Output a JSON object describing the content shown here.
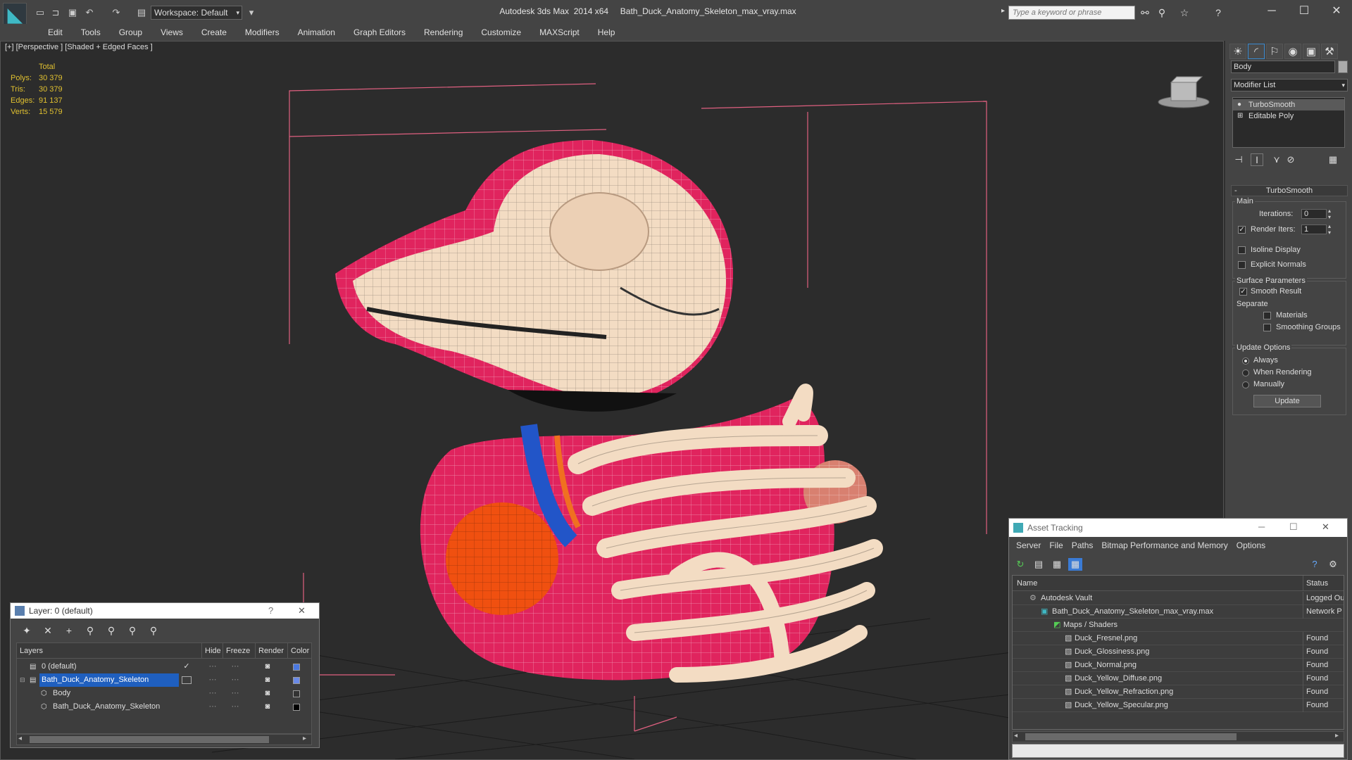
{
  "titlebar": {
    "app_title": "Autodesk 3ds Max  2014 x64     Bath_Duck_Anatomy_Skeleton_max_vray.max",
    "workspace_label": "Workspace: Default",
    "search_placeholder": "Type a keyword or phrase"
  },
  "menu": [
    "Edit",
    "Tools",
    "Group",
    "Views",
    "Create",
    "Modifiers",
    "Animation",
    "Graph Editors",
    "Rendering",
    "Customize",
    "MAXScript",
    "Help"
  ],
  "viewport": {
    "label": "[+] [Perspective ] [Shaded + Edged Faces ]",
    "stats_header": "Total",
    "stats": [
      {
        "k": "Polys:",
        "v": "30 379"
      },
      {
        "k": "Tris:",
        "v": "30 379"
      },
      {
        "k": "Edges:",
        "v": "91 137"
      },
      {
        "k": "Verts:",
        "v": "15 579"
      }
    ]
  },
  "command_panel": {
    "object_name": "Body",
    "modifier_list": "Modifier List",
    "stack": [
      "TurboSmooth",
      "Editable Poly"
    ],
    "rollout_title": "TurboSmooth",
    "main_group": "Main",
    "iterations_label": "Iterations:",
    "iterations_value": "0",
    "render_iters_label": "Render Iters:",
    "render_iters_value": "1",
    "isoline": "Isoline Display",
    "explicit": "Explicit Normals",
    "surface_group": "Surface Parameters",
    "smooth_result": "Smooth Result",
    "separate": "Separate",
    "materials": "Materials",
    "smoothing_groups": "Smoothing Groups",
    "update_group": "Update Options",
    "always": "Always",
    "when_rendering": "When Rendering",
    "manually": "Manually",
    "update_button": "Update"
  },
  "layer_window": {
    "title": "Layer: 0 (default)",
    "help": "?",
    "close": "✕",
    "columns": [
      "Layers",
      "Hide",
      "Freeze",
      "Render",
      "Color"
    ],
    "rows": [
      {
        "name": "0 (default)",
        "color": "#4a78e0"
      },
      {
        "name": "Bath_Duck_Anatomy_Skeleton",
        "color": "#6a8ae8"
      },
      {
        "name": "Body",
        "color": "#333333"
      },
      {
        "name": "Bath_Duck_Anatomy_Skeleton",
        "color": "#000000"
      }
    ]
  },
  "asset_window": {
    "title": "Asset Tracking",
    "menu": [
      "Server",
      "File",
      "Paths",
      "Bitmap Performance and Memory",
      "Options"
    ],
    "columns": [
      "Name",
      "Status"
    ],
    "rows": [
      {
        "name": "Autodesk Vault",
        "status": "Logged Ou"
      },
      {
        "name": "Bath_Duck_Anatomy_Skeleton_max_vray.max",
        "status": "Network P"
      },
      {
        "name": "Maps / Shaders",
        "status": ""
      },
      {
        "name": "Duck_Fresnel.png",
        "status": "Found"
      },
      {
        "name": "Duck_Glossiness.png",
        "status": "Found"
      },
      {
        "name": "Duck_Normal.png",
        "status": "Found"
      },
      {
        "name": "Duck_Yellow_Diffuse.png",
        "status": "Found"
      },
      {
        "name": "Duck_Yellow_Refraction.png",
        "status": "Found"
      },
      {
        "name": "Duck_Yellow_Specular.png",
        "status": "Found"
      }
    ]
  },
  "colors": {
    "accent": "#3fb9c5",
    "selection": "#1f5fbf",
    "stats": "#e0c030",
    "wire": "#e06080",
    "bone": "#f3dcc3",
    "flesh": "#e0245e",
    "orange": "#f05010"
  }
}
